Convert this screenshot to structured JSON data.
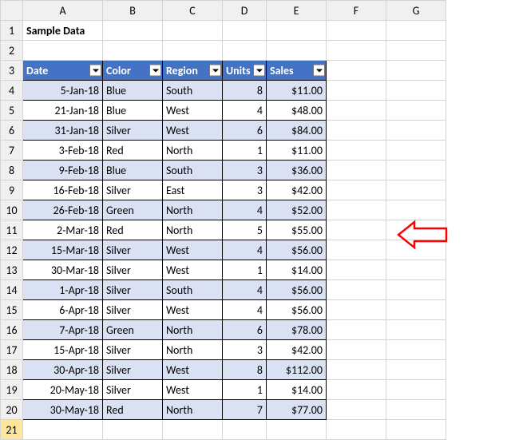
{
  "columns": [
    "A",
    "B",
    "C",
    "D",
    "E",
    "F",
    "G"
  ],
  "rows": [
    1,
    2,
    3,
    4,
    5,
    6,
    7,
    8,
    9,
    10,
    11,
    12,
    13,
    14,
    15,
    16,
    17,
    18,
    19,
    20,
    21
  ],
  "selected_row": 21,
  "title_cell": "Sample Data",
  "headers": {
    "date": "Date",
    "color": "Color",
    "region": "Region",
    "units": "Units",
    "sales": "Sales"
  },
  "table": [
    {
      "date": "5-Jan-18",
      "color": "Blue",
      "region": "South",
      "units": "8",
      "sales": "$11.00",
      "band": true
    },
    {
      "date": "21-Jan-18",
      "color": "Blue",
      "region": "West",
      "units": "4",
      "sales": "$48.00",
      "band": false
    },
    {
      "date": "31-Jan-18",
      "color": "Silver",
      "region": "West",
      "units": "6",
      "sales": "$84.00",
      "band": true
    },
    {
      "date": "3-Feb-18",
      "color": "Red",
      "region": "North",
      "units": "1",
      "sales": "$11.00",
      "band": false
    },
    {
      "date": "9-Feb-18",
      "color": "Blue",
      "region": "South",
      "units": "3",
      "sales": "$36.00",
      "band": true
    },
    {
      "date": "16-Feb-18",
      "color": "Silver",
      "region": "East",
      "units": "3",
      "sales": "$42.00",
      "band": false
    },
    {
      "date": "26-Feb-18",
      "color": "Green",
      "region": "North",
      "units": "4",
      "sales": "$52.00",
      "band": true
    },
    {
      "date": "2-Mar-18",
      "color": "Red",
      "region": "North",
      "units": "5",
      "sales": "$55.00",
      "band": false
    },
    {
      "date": "15-Mar-18",
      "color": "Silver",
      "region": "West",
      "units": "4",
      "sales": "$56.00",
      "band": true
    },
    {
      "date": "30-Mar-18",
      "color": "Silver",
      "region": "West",
      "units": "1",
      "sales": "$14.00",
      "band": false
    },
    {
      "date": "1-Apr-18",
      "color": "Silver",
      "region": "South",
      "units": "4",
      "sales": "$56.00",
      "band": true
    },
    {
      "date": "6-Apr-18",
      "color": "Silver",
      "region": "West",
      "units": "4",
      "sales": "$56.00",
      "band": false
    },
    {
      "date": "7-Apr-18",
      "color": "Green",
      "region": "North",
      "units": "6",
      "sales": "$78.00",
      "band": true
    },
    {
      "date": "15-Apr-18",
      "color": "Silver",
      "region": "North",
      "units": "3",
      "sales": "$42.00",
      "band": false
    },
    {
      "date": "30-Apr-18",
      "color": "Silver",
      "region": "West",
      "units": "8",
      "sales": "$112.00",
      "band": true
    },
    {
      "date": "20-May-18",
      "color": "Silver",
      "region": "West",
      "units": "1",
      "sales": "$14.00",
      "band": false
    },
    {
      "date": "30-May-18",
      "color": "Red",
      "region": "North",
      "units": "7",
      "sales": "$77.00",
      "band": true
    }
  ]
}
